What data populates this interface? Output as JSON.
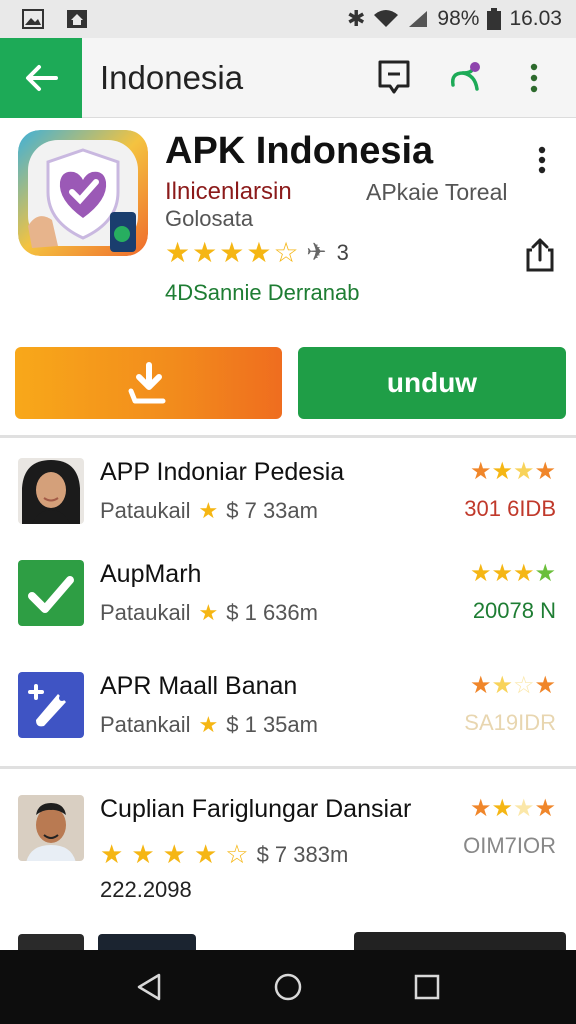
{
  "status_bar": {
    "battery": "98%",
    "time": "16.03"
  },
  "app_bar": {
    "title": "Indonesia"
  },
  "app": {
    "name": "APK Indonesia",
    "developer": "Ilnicenlarsin",
    "category": "APkaie Toreal",
    "subtitle": "Golosata",
    "rating_stars": 4.5,
    "rating_count": "3",
    "downloads": "4DSannie Derranab"
  },
  "buttons": {
    "unduh_label": "unduw"
  },
  "list": [
    {
      "title": "APP Indoniar Pedesia",
      "meta_label": "Pataukail",
      "meta_value": "$ 7 33am",
      "stars": 3.5,
      "size": "301 6IDB",
      "size_color": "#c0392b"
    },
    {
      "title": "AupMarh",
      "meta_label": "Pataukail",
      "meta_value": "$ 1 636m",
      "stars": 4,
      "size": "20078 N",
      "size_color": "#1e7d33"
    },
    {
      "title": "APR Maall Banan",
      "meta_label": "Patankail",
      "meta_value": "$ 1 35am",
      "stars": 3,
      "size": "SA19IDR",
      "size_color": "#e8d6b0"
    },
    {
      "title": "Cuplian Fariglungar Dansiar",
      "meta_label": "",
      "meta_value": "$ 7 383m",
      "stars": 3,
      "size": "OIM7IOR",
      "size_color": "#888888",
      "extra": "222.2098"
    }
  ],
  "colors": {
    "accent_green": "#1daa57",
    "unduh_green": "#1f9e47",
    "download_orange": "#f28b1c",
    "star": "#f5b614"
  },
  "icons": {
    "back": "arrow-left-icon",
    "comment": "comment-icon",
    "share_graph": "share-icon",
    "more": "more-vertical-icon",
    "share": "share-out-icon",
    "download": "download-icon"
  }
}
